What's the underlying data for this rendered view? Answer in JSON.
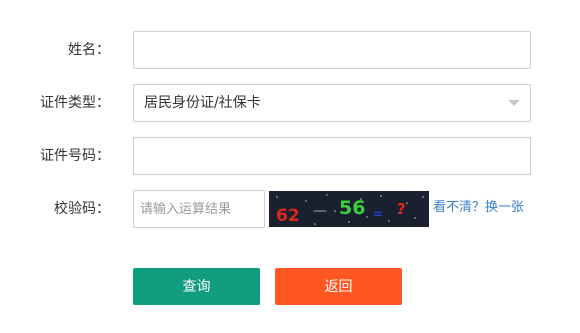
{
  "form": {
    "name": {
      "label": "姓名：",
      "value": ""
    },
    "id_type": {
      "label": "证件类型：",
      "selected": "居民身份证/社保卡"
    },
    "id_number": {
      "label": "证件号码：",
      "value": ""
    },
    "captcha": {
      "label": "校验码：",
      "placeholder": "请输入运算结果",
      "image_text": {
        "operand1": "62",
        "operator": "—",
        "operand2": "56",
        "equals": "=",
        "question": "?"
      },
      "refresh_link": "看不清？换一张"
    }
  },
  "buttons": {
    "query_label": "查询",
    "back_label": "返回"
  },
  "colors": {
    "query_button": "#129d80",
    "back_button": "#fe5722",
    "link": "#3d7ec9",
    "captcha_bg": "#1a2030",
    "captcha_operand1": "#e0261b",
    "captcha_operator": "#9aa0a8",
    "captcha_operand2": "#36d23a",
    "captcha_equals": "#2a3fd0",
    "captcha_question": "#e0261b"
  }
}
